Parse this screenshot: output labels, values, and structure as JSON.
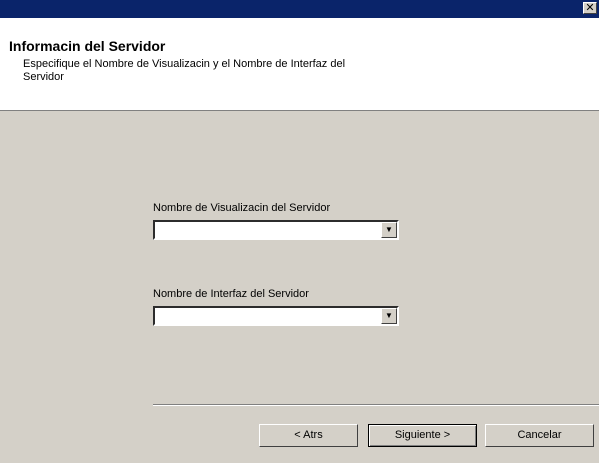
{
  "window": {
    "close_glyph": "✕"
  },
  "header": {
    "title": "Informacin del Servidor",
    "description": "Especifique el Nombre de Visualizacin y el Nombre de Interfaz del Servidor"
  },
  "fields": {
    "display_name": {
      "label": "Nombre de Visualizacin del Servidor",
      "value": ""
    },
    "interface_name": {
      "label": "Nombre de Interfaz del Servidor",
      "value": ""
    }
  },
  "buttons": {
    "back": "< Atrs",
    "next": "Siguiente >",
    "cancel": "Cancelar"
  }
}
